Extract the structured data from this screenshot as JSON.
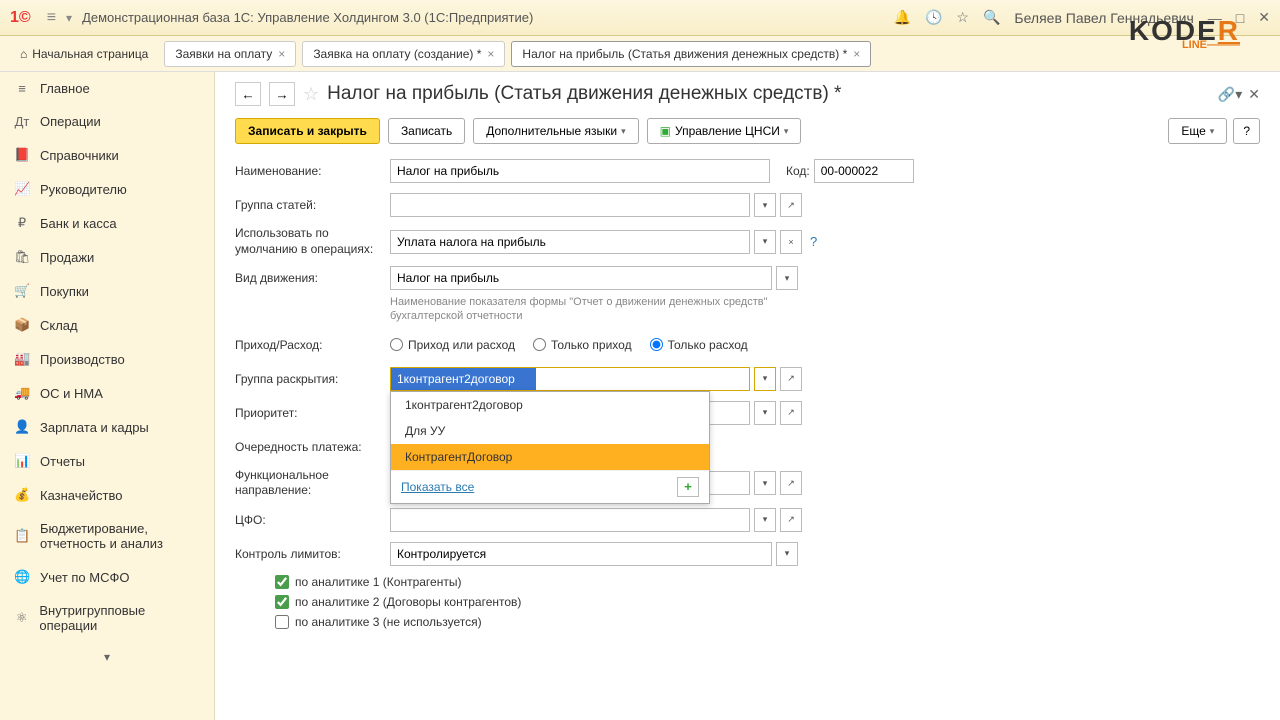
{
  "app": {
    "title": "Демонстрационная база 1С: Управление Холдингом 3.0  (1С:Предприятие)",
    "user": "Беляев Павел Геннадьевич"
  },
  "tabs": {
    "home": "Начальная страница",
    "items": [
      {
        "label": "Заявки на оплату",
        "close": true
      },
      {
        "label": "Заявка на оплату (создание) *",
        "close": true
      },
      {
        "label": "Налог на прибыль (Статья движения денежных средств) *",
        "close": true,
        "active": true
      }
    ]
  },
  "sidebar": [
    {
      "icon": "≡",
      "label": "Главное"
    },
    {
      "icon": "Дт",
      "label": "Операции"
    },
    {
      "icon": "📕",
      "label": "Справочники"
    },
    {
      "icon": "📈",
      "label": "Руководителю"
    },
    {
      "icon": "₽",
      "label": "Банк и касса"
    },
    {
      "icon": "🛍",
      "label": "Продажи"
    },
    {
      "icon": "🛒",
      "label": "Покупки"
    },
    {
      "icon": "📦",
      "label": "Склад"
    },
    {
      "icon": "🏭",
      "label": "Производство"
    },
    {
      "icon": "🚚",
      "label": "ОС и НМА"
    },
    {
      "icon": "👤",
      "label": "Зарплата и кадры"
    },
    {
      "icon": "📊",
      "label": "Отчеты"
    },
    {
      "icon": "💰",
      "label": "Казначейство"
    },
    {
      "icon": "📋",
      "label": "Бюджетирование, отчетность и анализ"
    },
    {
      "icon": "🌐",
      "label": "Учет по МСФО"
    },
    {
      "icon": "⚛",
      "label": "Внутригрупповые операции"
    }
  ],
  "page": {
    "title": "Налог на прибыль (Статья движения денежных средств) *"
  },
  "toolbar": {
    "save_close": "Записать и закрыть",
    "save": "Записать",
    "langs": "Дополнительные языки",
    "cnsi": "Управление ЦНСИ",
    "more": "Еще"
  },
  "form": {
    "name_label": "Наименование:",
    "name_value": "Налог на прибыль",
    "code_label": "Код:",
    "code_value": "00-000022",
    "group_label": "Группа статей:",
    "group_value": "",
    "default_op_label": "Использовать по умолчанию в операциях:",
    "default_op_value": "Уплата налога на прибыль",
    "movement_label": "Вид движения:",
    "movement_value": "Налог на прибыль",
    "movement_hint": "Наименование показателя формы \"Отчет о движении денежных средств\" бухгалтерской отчетности",
    "in_out_label": "Приход/Расход:",
    "radio1": "Приход или расход",
    "radio2": "Только приход",
    "radio3": "Только расход",
    "disclosure_label": "Группа раскрытия:",
    "disclosure_value": "1контрагент2договор",
    "priority_label": "Приоритет:",
    "payment_order_label": "Очередность платежа:",
    "func_dir_label": "Функциональное направление:",
    "cfo_label": "ЦФО:",
    "limit_label": "Контроль лимитов:",
    "limit_value": "Контролируется",
    "chk1": "по аналитике 1 (Контрагенты)",
    "chk2": "по аналитике 2 (Договоры контрагентов)",
    "chk3": "по аналитике 3 (не используется)"
  },
  "dropdown": {
    "items": [
      "1контрагент2договор",
      "Для УУ",
      "КонтрагентДоговор"
    ],
    "selected": 2,
    "show_all": "Показать все"
  }
}
